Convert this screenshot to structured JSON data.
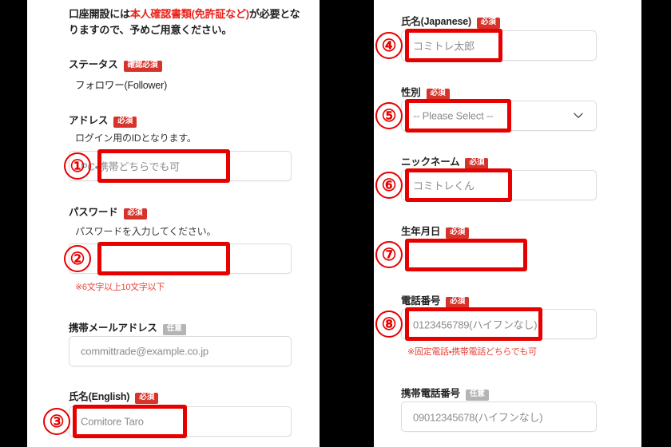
{
  "annotations": {
    "markers": [
      "①",
      "②",
      "③",
      "④",
      "⑤",
      "⑥",
      "⑦",
      "⑧"
    ],
    "highlight_color": "#e60000"
  },
  "badges": {
    "required": "必須",
    "required_confirm": "確認必須",
    "optional": "任意"
  },
  "left_panel": {
    "intro": {
      "before": "口座開設には",
      "highlight": "本人確認書類(免許証など)",
      "after": "が必要となりますので、予めご用意ください。"
    },
    "fields": [
      {
        "label": "ステータス",
        "badge": "確認必須",
        "value": "フォロワー(Follower)"
      },
      {
        "label": "アドレス",
        "badge": "必須",
        "helper": "ログイン用のIDとなります。",
        "placeholder": "PC・携帯どちらでも可",
        "marker": "①"
      },
      {
        "label": "パスワード",
        "badge": "必須",
        "helper": "パスワードを入力してください。",
        "placeholder": "",
        "note": "※6文字以上10文字以下",
        "marker": "②"
      },
      {
        "label": "携帯メールアドレス",
        "badge": "任意",
        "placeholder": "committrade@example.co.jp"
      },
      {
        "label": "氏名(English)",
        "badge": "必須",
        "placeholder": "Comitore Taro",
        "marker": "③"
      }
    ]
  },
  "right_panel": {
    "fields": [
      {
        "label": "氏名(Japanese)",
        "badge": "必須",
        "placeholder": "コミトレ太郎",
        "marker": "④"
      },
      {
        "label": "性別",
        "badge": "必須",
        "placeholder": "-- Please Select --",
        "icon": "chevron-down-icon",
        "marker": "⑤"
      },
      {
        "label": "ニックネーム",
        "badge": "必須",
        "placeholder": "コミトレくん",
        "marker": "⑥"
      },
      {
        "label": "生年月日",
        "badge": "必須",
        "placeholder": "",
        "marker": "⑦"
      },
      {
        "label": "電話番号",
        "badge": "必須",
        "placeholder": "0123456789(ハイフンなし)",
        "note": "※固定電話・携帯電話どちらでも可",
        "marker": "⑧"
      },
      {
        "label": "携帯電話番号",
        "badge": "任意",
        "placeholder": "09012345678(ハイフンなし)"
      }
    ]
  }
}
